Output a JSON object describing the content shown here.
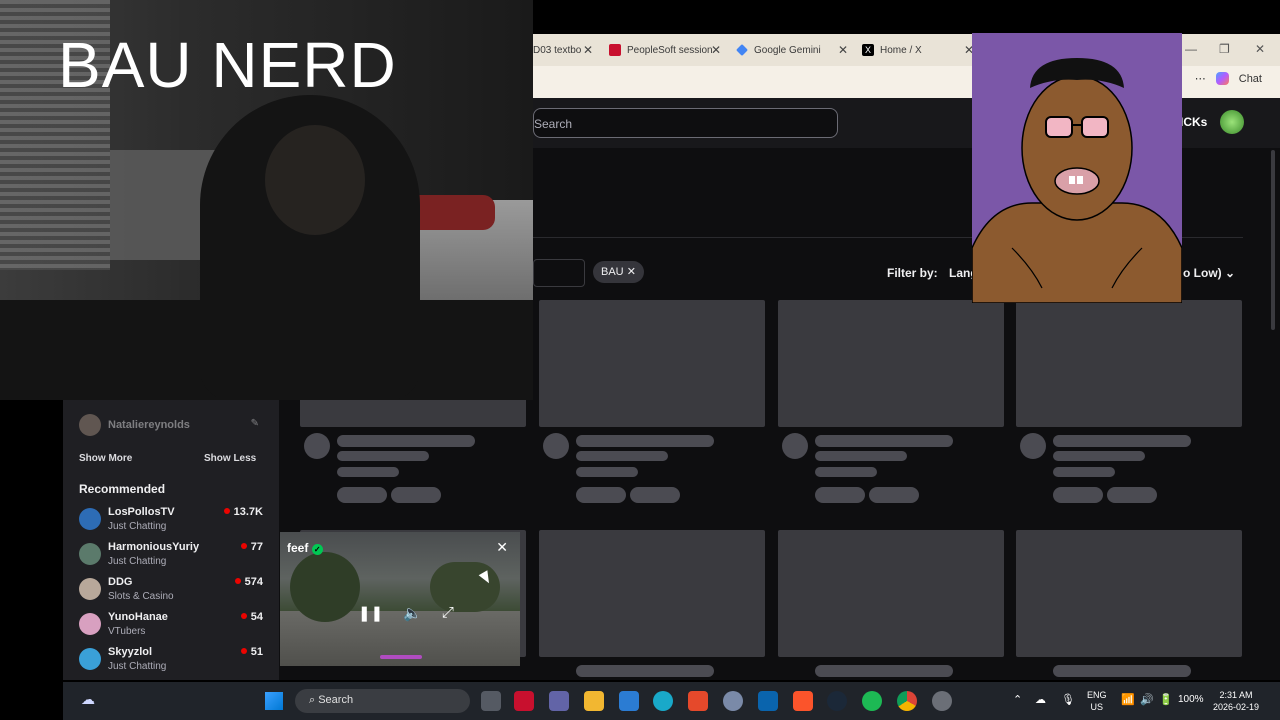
{
  "webcam": {
    "title": "BAU NERD"
  },
  "browser": {
    "tabs": [
      {
        "label": "D03 textbo",
        "icon_color": "#c0392b"
      },
      {
        "label": "PeopleSoft session",
        "icon_color": "#c8102e"
      },
      {
        "label": "Google Gemini",
        "icon_color": "#4285f4"
      },
      {
        "label": "Home / X",
        "icon_color": "#000000"
      }
    ],
    "chat_label": "Chat",
    "window_icons": [
      "minimize-icon",
      "restore-icon",
      "close-icon"
    ]
  },
  "twitch": {
    "search_placeholder": "Search",
    "header_partial": "ICKs",
    "tag": "BAU",
    "filter_label": "Filter by:",
    "language_partial": "Lang",
    "sort_partial": "o Low)",
    "accent_color": "#9147ff",
    "sidebar": {
      "followed_partial": "Nataliereynolds",
      "show_more": "Show More",
      "show_less": "Show Less",
      "recommended_title": "Recommended",
      "channels": [
        {
          "name": "LosPollosTV",
          "category": "Just Chatting",
          "viewers": "13.7K",
          "avatar_color": "#2d6cb5"
        },
        {
          "name": "HarmoniousYuriy",
          "category": "Just Chatting",
          "viewers": "77",
          "avatar_color": "#5b7a6b"
        },
        {
          "name": "DDG",
          "category": "Slots & Casino",
          "viewers": "574",
          "avatar_color": "#b8a89a"
        },
        {
          "name": "YunoHanae",
          "category": "VTubers",
          "viewers": "54",
          "avatar_color": "#d8a0c0"
        },
        {
          "name": "Skyyzlol",
          "category": "Just Chatting",
          "viewers": "51",
          "avatar_color": "#3aa0d8"
        }
      ]
    },
    "miniplayer": {
      "channel": "feef",
      "verified": true
    }
  },
  "taskbar": {
    "search_label": "Search",
    "language": "ENG",
    "region": "US",
    "battery": "100%",
    "time": "2:31 AM",
    "date": "2026-02-19"
  }
}
